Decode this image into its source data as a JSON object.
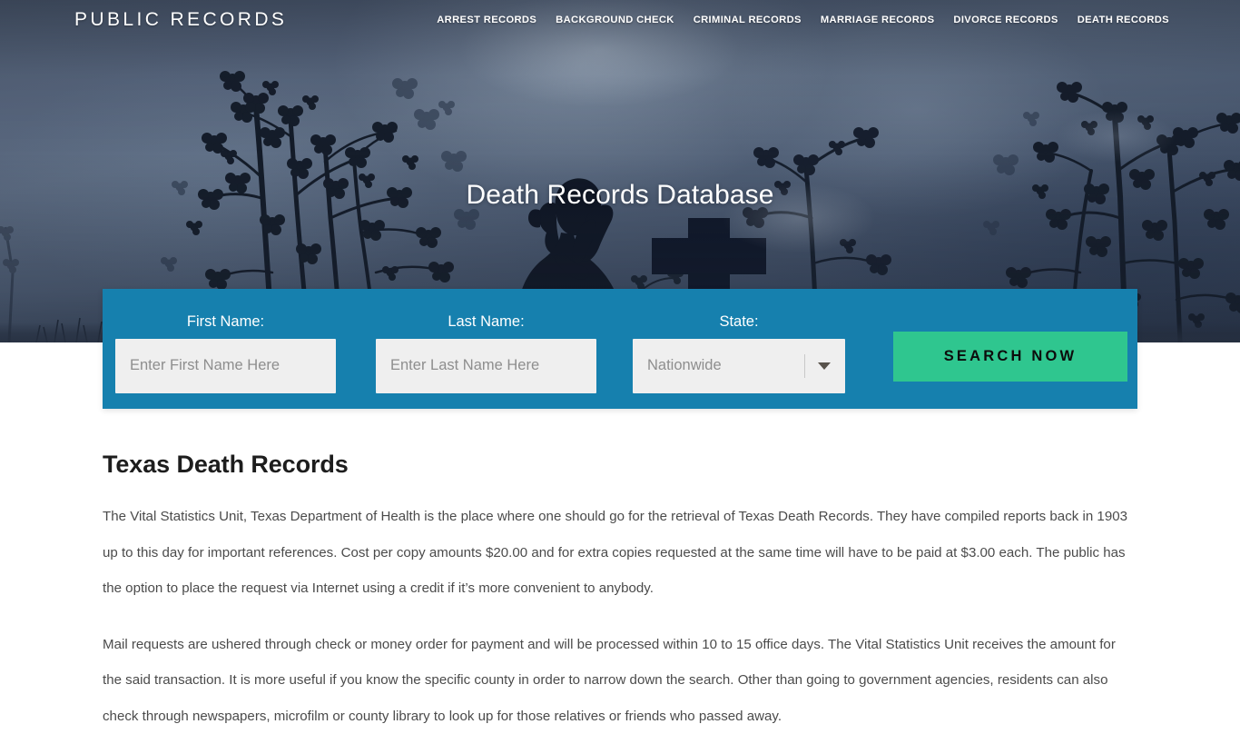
{
  "header": {
    "logo": "PUBLIC RECORDS",
    "nav": [
      {
        "label": "ARREST RECORDS"
      },
      {
        "label": "BACKGROUND CHECK"
      },
      {
        "label": "CRIMINAL RECORDS"
      },
      {
        "label": "MARRIAGE RECORDS"
      },
      {
        "label": "DIVORCE RECORDS"
      },
      {
        "label": "DEATH RECORDS"
      }
    ]
  },
  "hero": {
    "title": "Death Records Database",
    "background_description": "blossom-tree-silhouette-praying-girl-and-cross-at-dusk"
  },
  "search": {
    "bar_color": "#1680ae",
    "first_name": {
      "label": "First Name:",
      "placeholder": "Enter First Name Here",
      "value": ""
    },
    "last_name": {
      "label": "Last Name:",
      "placeholder": "Enter Last Name Here",
      "value": ""
    },
    "state": {
      "label": "State:",
      "selected": "Nationwide"
    },
    "submit": {
      "label": "SEARCH NOW",
      "color": "#2fc68f"
    }
  },
  "main": {
    "title": "Texas Death Records",
    "paragraphs": [
      "The Vital Statistics Unit, Texas Department of Health is the place where one should go for the retrieval of Texas Death Records. They have compiled reports back in 1903 up to this day for important references. Cost per copy amounts $20.00 and for extra copies requested at the same time will have to be paid at $3.00 each. The public has the option to place the request via Internet using a credit if it’s more convenient to anybody.",
      "Mail requests are ushered through check or money order for payment and will be processed within 10 to 15 office days. The Vital Statistics Unit receives the amount for the said transaction. It is more useful if you know the specific county in order to narrow down the search. Other than going to government agencies, residents can also check through newspapers, microfilm or county library to look up for those relatives or friends who passed away."
    ]
  }
}
